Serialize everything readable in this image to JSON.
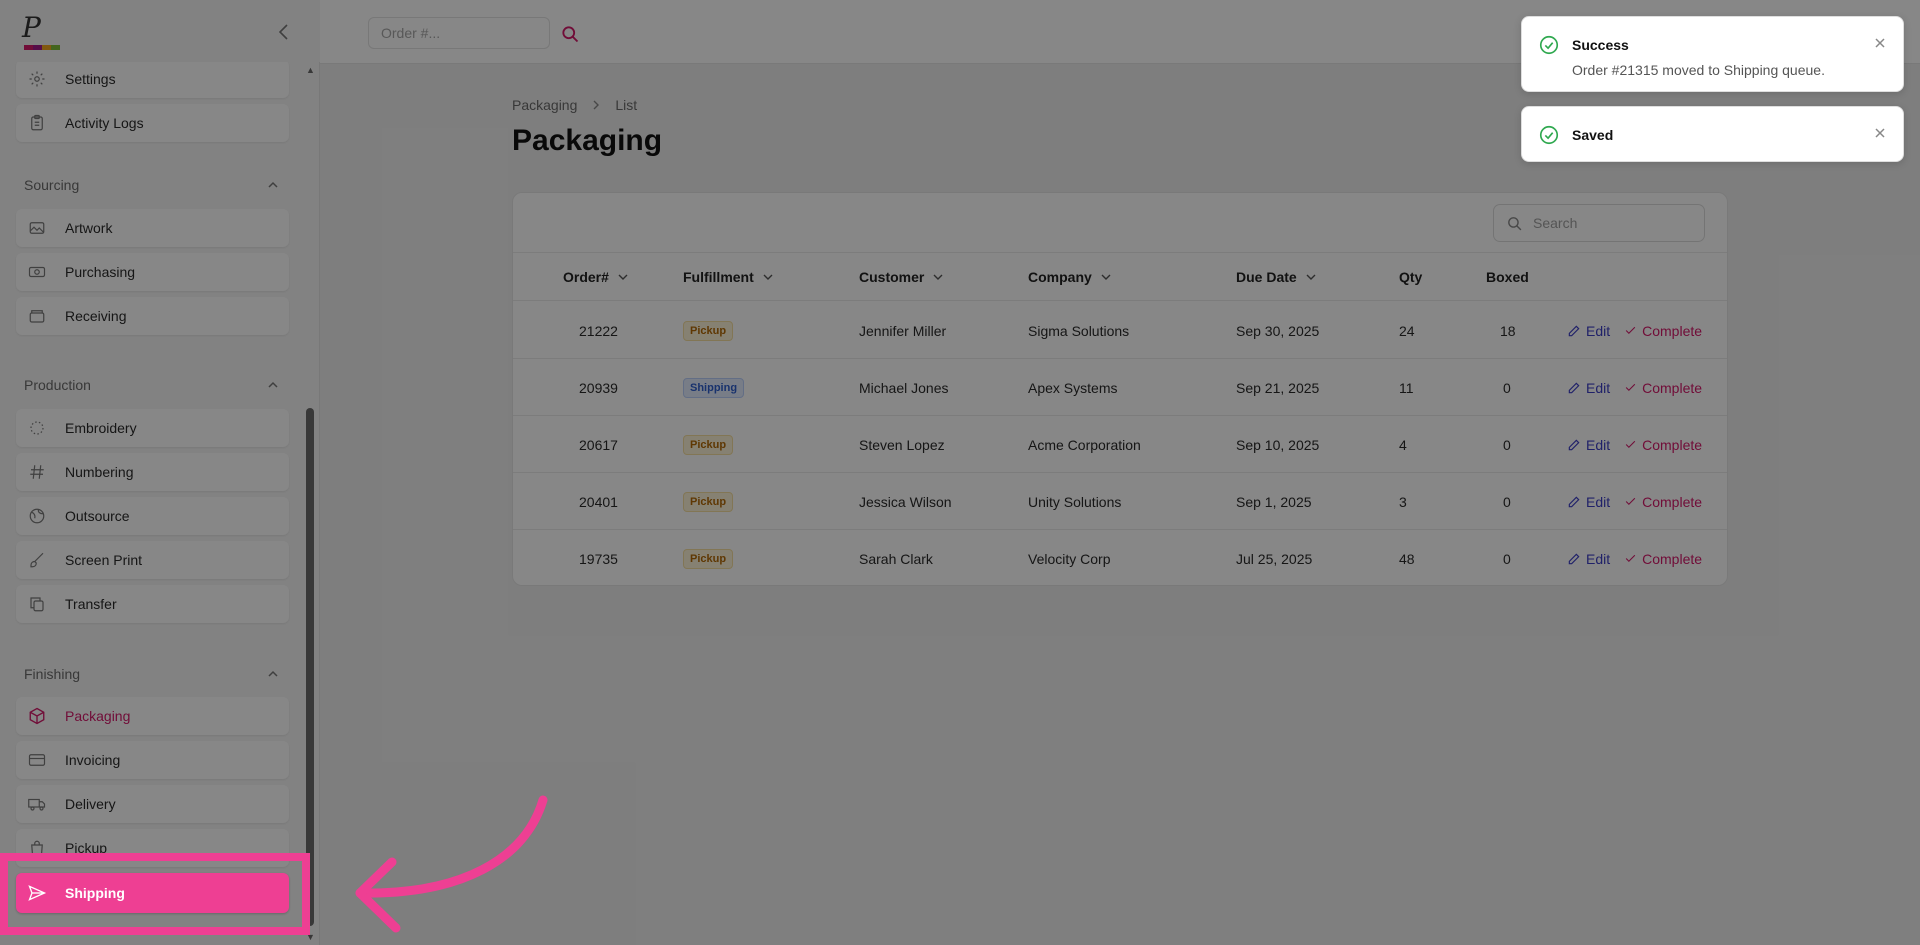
{
  "brand": {
    "logo_letter": "P",
    "colors": [
      "#d51a6b",
      "#a3198a",
      "#f4a61d",
      "#7fbf3a"
    ]
  },
  "topbar": {
    "order_placeholder": "Order #..."
  },
  "sidebar": {
    "top_items": [
      {
        "label": "Settings",
        "icon": "gear-icon"
      },
      {
        "label": "Activity Logs",
        "icon": "clipboard-icon"
      }
    ],
    "sections": [
      {
        "title": "Sourcing",
        "items": [
          {
            "label": "Artwork",
            "icon": "image-icon"
          },
          {
            "label": "Purchasing",
            "icon": "money-icon"
          },
          {
            "label": "Receiving",
            "icon": "box-icon"
          }
        ]
      },
      {
        "title": "Production",
        "items": [
          {
            "label": "Embroidery",
            "icon": "needle-icon"
          },
          {
            "label": "Numbering",
            "icon": "hash-icon"
          },
          {
            "label": "Outsource",
            "icon": "globe-icon"
          },
          {
            "label": "Screen Print",
            "icon": "brush-icon"
          },
          {
            "label": "Transfer",
            "icon": "copy-icon"
          }
        ]
      },
      {
        "title": "Finishing",
        "items": [
          {
            "label": "Packaging",
            "icon": "package-icon"
          },
          {
            "label": "Invoicing",
            "icon": "credit-card-icon"
          },
          {
            "label": "Delivery",
            "icon": "truck-icon"
          },
          {
            "label": "Pickup",
            "icon": "shopping-bag-icon"
          }
        ]
      }
    ],
    "highlighted_item": {
      "label": "Shipping",
      "icon": "send-icon"
    }
  },
  "main": {
    "breadcrumb": [
      "Packaging",
      "List"
    ],
    "title": "Packaging",
    "search_placeholder": "Search",
    "columns": [
      "Order#",
      "Fulfillment",
      "Customer",
      "Company",
      "Due Date",
      "Qty",
      "Boxed"
    ],
    "rows": [
      {
        "order": "21222",
        "fulfillment": "Pickup",
        "customer": "Jennifer Miller",
        "company": "Sigma Solutions",
        "due": "Sep 30, 2025",
        "qty": "24",
        "boxed": "18"
      },
      {
        "order": "20939",
        "fulfillment": "Shipping",
        "customer": "Michael Jones",
        "company": "Apex Systems",
        "due": "Sep 21, 2025",
        "qty": "11",
        "boxed": "0"
      },
      {
        "order": "20617",
        "fulfillment": "Pickup",
        "customer": "Steven Lopez",
        "company": "Acme Corporation",
        "due": "Sep 10, 2025",
        "qty": "4",
        "boxed": "0"
      },
      {
        "order": "20401",
        "fulfillment": "Pickup",
        "customer": "Jessica Wilson",
        "company": "Unity Solutions",
        "due": "Sep 1, 2025",
        "qty": "3",
        "boxed": "0"
      },
      {
        "order": "19735",
        "fulfillment": "Pickup",
        "customer": "Sarah Clark",
        "company": "Velocity Corp",
        "due": "Jul 25, 2025",
        "qty": "48",
        "boxed": "0"
      }
    ],
    "actions": {
      "edit": "Edit",
      "complete": "Complete"
    }
  },
  "toasts": [
    {
      "title": "Success",
      "message": "Order #21315 moved to Shipping queue."
    },
    {
      "title": "Saved",
      "message": ""
    }
  ],
  "accent": "#d51a6b",
  "highlight_color": "#ee3f93"
}
